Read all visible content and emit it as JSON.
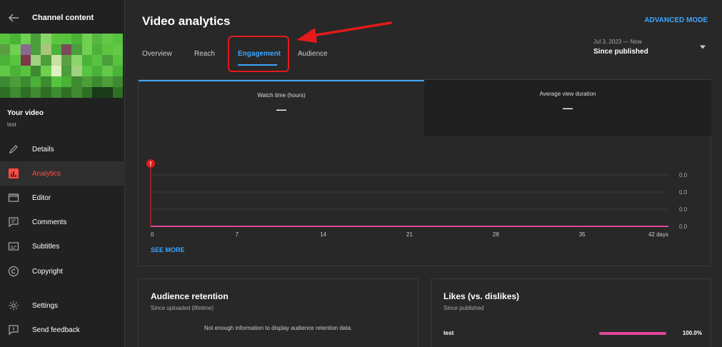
{
  "sidebar": {
    "title": "Channel content",
    "your_video": "Your video",
    "video_name": "test",
    "items": [
      {
        "label": "Details",
        "icon": "pencil-icon"
      },
      {
        "label": "Analytics",
        "icon": "analytics-icon",
        "active": true
      },
      {
        "label": "Editor",
        "icon": "film-icon"
      },
      {
        "label": "Comments",
        "icon": "comment-icon"
      },
      {
        "label": "Subtitles",
        "icon": "subtitles-icon"
      },
      {
        "label": "Copyright",
        "icon": "copyright-icon"
      },
      {
        "label": "Settings",
        "icon": "gear-icon"
      },
      {
        "label": "Send feedback",
        "icon": "feedback-icon"
      }
    ]
  },
  "header": {
    "title": "Video analytics",
    "advanced_mode": "ADVANCED MODE",
    "tabs": [
      {
        "label": "Overview"
      },
      {
        "label": "Reach"
      },
      {
        "label": "Engagement",
        "active": true
      },
      {
        "label": "Audience"
      }
    ],
    "date_range": "Jul 3, 2023 — Now",
    "date_label": "Since published"
  },
  "metrics": [
    {
      "label": "Watch time (hours)",
      "value": "—"
    },
    {
      "label": "Average view duration",
      "value": "—"
    }
  ],
  "see_more": "SEE MORE",
  "chart_data": {
    "type": "line",
    "x_ticks": [
      "0",
      "7",
      "14",
      "21",
      "28",
      "35",
      "42 days"
    ],
    "y_ticks": [
      "0.0",
      "0.0",
      "0.0",
      "0.0"
    ],
    "x": [
      0,
      42
    ],
    "series": [
      {
        "values": [
          0,
          0
        ]
      }
    ],
    "xlim": [
      0,
      42
    ],
    "grid": true,
    "colors": {
      "line": "#e3469c",
      "marker": "#e3191c"
    }
  },
  "retention": {
    "title": "Audience retention",
    "subtitle": "Since uploaded (lifetime)",
    "message": "Not enough information to display audience retention data."
  },
  "likes": {
    "title": "Likes (vs. dislikes)",
    "subtitle": "Since published",
    "label": "test",
    "percent_text": "100.0%",
    "fraction": 1.0
  },
  "colors": {
    "accent": "#3ea6ff",
    "active_nav": "#ff4e45",
    "highlight": "#e3191c"
  }
}
